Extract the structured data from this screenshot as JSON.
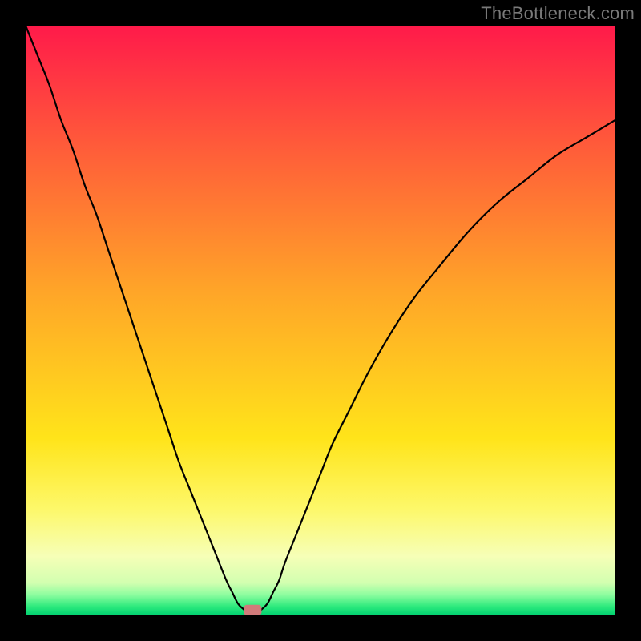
{
  "watermark": "TheBottleneck.com",
  "chart_data": {
    "type": "line",
    "title": "",
    "xlabel": "",
    "ylabel": "",
    "xlim": [
      0,
      100
    ],
    "ylim": [
      0,
      100
    ],
    "grid": false,
    "annotations": [],
    "background_gradient_stops": [
      {
        "pos": 0.0,
        "color": "#ff1a4a"
      },
      {
        "pos": 0.2,
        "color": "#ff5a3a"
      },
      {
        "pos": 0.45,
        "color": "#ffa528"
      },
      {
        "pos": 0.7,
        "color": "#ffe41a"
      },
      {
        "pos": 0.82,
        "color": "#fdf86a"
      },
      {
        "pos": 0.9,
        "color": "#f6ffb7"
      },
      {
        "pos": 0.945,
        "color": "#d2ffb0"
      },
      {
        "pos": 0.965,
        "color": "#8dfd9f"
      },
      {
        "pos": 0.985,
        "color": "#2dea7d"
      },
      {
        "pos": 1.0,
        "color": "#00d070"
      }
    ],
    "series": [
      {
        "name": "bottleneck-curve",
        "stroke": "#000000",
        "stroke_width": 2.2,
        "x": [
          0,
          2,
          4,
          6,
          8,
          10,
          12,
          14,
          16,
          18,
          20,
          22,
          24,
          26,
          28,
          30,
          32,
          34,
          35,
          36,
          37,
          38,
          39,
          40,
          41,
          42,
          43,
          44,
          46,
          48,
          50,
          52,
          55,
          58,
          62,
          66,
          70,
          75,
          80,
          85,
          90,
          95,
          100
        ],
        "y": [
          100,
          95,
          90,
          84,
          79,
          73,
          68,
          62,
          56,
          50,
          44,
          38,
          32,
          26,
          21,
          16,
          11,
          6,
          4,
          2,
          1,
          0,
          0,
          1,
          2,
          4,
          6,
          9,
          14,
          19,
          24,
          29,
          35,
          41,
          48,
          54,
          59,
          65,
          70,
          74,
          78,
          81,
          84
        ]
      }
    ],
    "marker": {
      "x": 38.5,
      "y": 0,
      "w": 3.0,
      "h": 1.8,
      "color": "#d17a7a"
    }
  }
}
